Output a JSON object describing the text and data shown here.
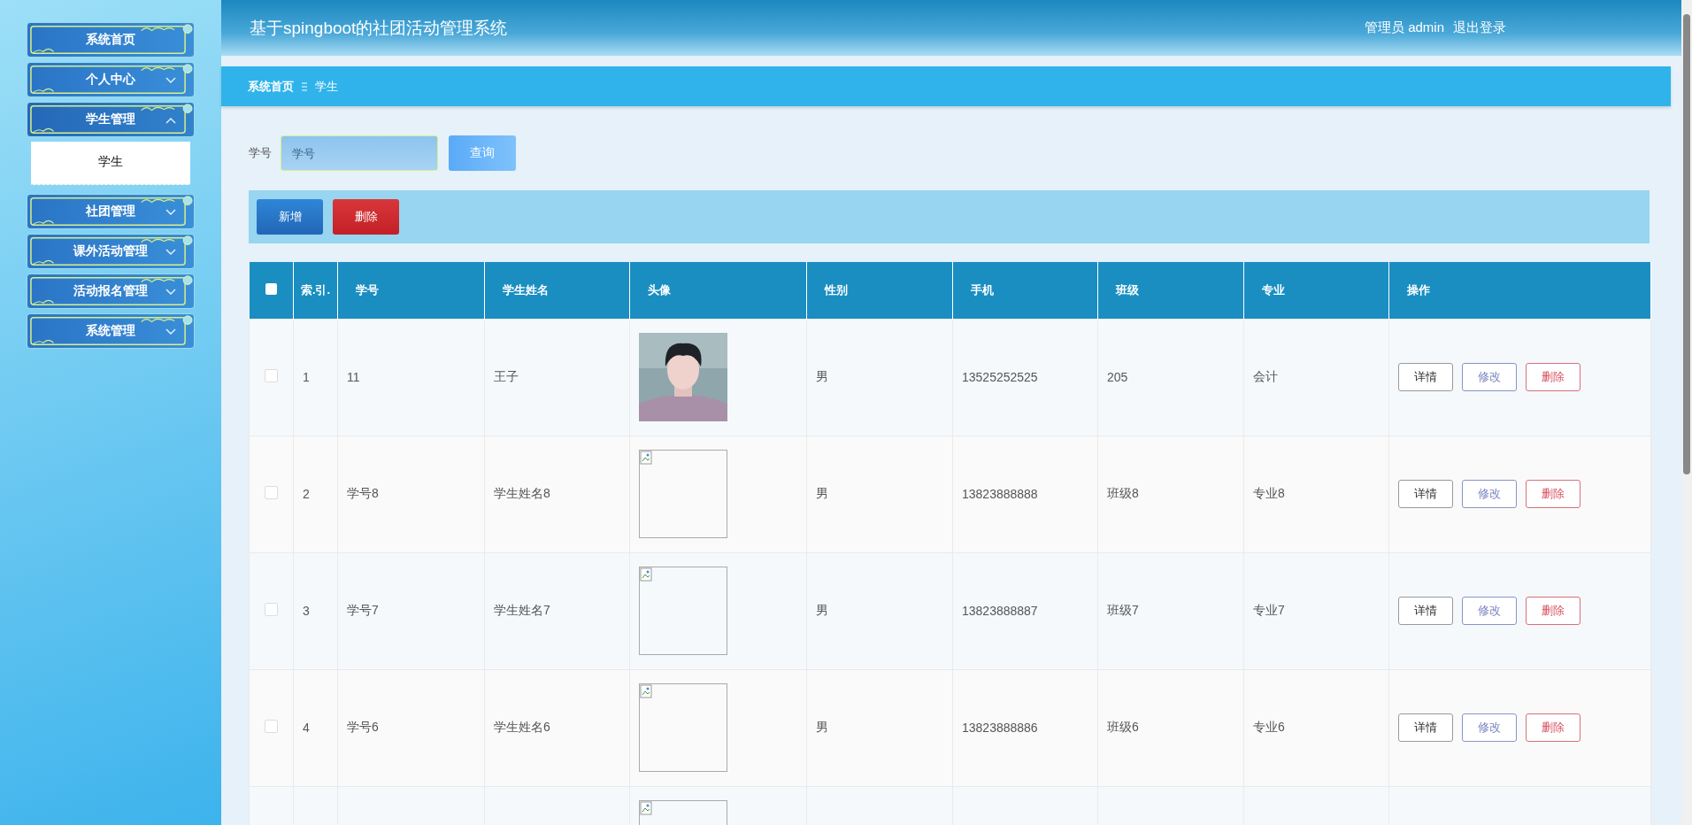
{
  "sidebar": {
    "items": [
      {
        "label": "系统首页"
      },
      {
        "label": "个人中心",
        "expanded": false
      },
      {
        "label": "学生管理",
        "expanded": true,
        "children": [
          {
            "label": "学生"
          }
        ]
      },
      {
        "label": "社团管理",
        "expanded": false
      },
      {
        "label": "课外活动管理",
        "expanded": false
      },
      {
        "label": "活动报名管理",
        "expanded": false
      },
      {
        "label": "系统管理",
        "expanded": false
      }
    ]
  },
  "header": {
    "title": "基于spingboot的社团活动管理系统",
    "user": "管理员 admin",
    "logout": "退出登录"
  },
  "breadcrumb": [
    "系统首页",
    "学生"
  ],
  "search": {
    "label": "学号",
    "placeholder": "学号",
    "button": "查询"
  },
  "actions": [
    {
      "label": "新增",
      "kind": "primary"
    },
    {
      "label": "删除",
      "kind": "danger"
    }
  ],
  "table": {
    "select_all": {
      "checked": false
    },
    "columns": [
      "索.引.",
      "学号",
      "学生姓名",
      "头像",
      "性别",
      "手机",
      "班级",
      "专业",
      "操作"
    ],
    "rows": [
      {
        "checked": false,
        "index": "1",
        "id": "11",
        "name": "王子",
        "gender": "男",
        "phone": "13525252525",
        "class": "205",
        "major": "会计",
        "buttons": [
          "详情",
          "修改",
          "删除"
        ]
      },
      {
        "checked": false,
        "index": "2",
        "id": "学号8",
        "name": "学生姓名8",
        "avatar": {
          "kind": "broken"
        },
        "gender": "男",
        "phone": "13823888888",
        "class": "班级8",
        "major": "专业8",
        "buttons": [
          "详情",
          "修改",
          "删除"
        ]
      },
      {
        "checked": false,
        "index": "3",
        "id": "学号7",
        "name": "学生姓名7",
        "avatar": {
          "kind": "broken"
        },
        "gender": "男",
        "phone": "13823888887",
        "class": "班级7",
        "major": "专业7",
        "buttons": [
          "详情",
          "修改",
          "删除"
        ]
      },
      {
        "checked": false,
        "index": "4",
        "id": "学号6",
        "name": "学生姓名6",
        "avatar": {
          "kind": "broken"
        },
        "gender": "男",
        "phone": "13823888886",
        "class": "班级6",
        "major": "专业6",
        "buttons": [
          "详情",
          "修改",
          "删除"
        ]
      },
      {
        "avatar": {
          "kind": "broken"
        }
      }
    ]
  }
}
